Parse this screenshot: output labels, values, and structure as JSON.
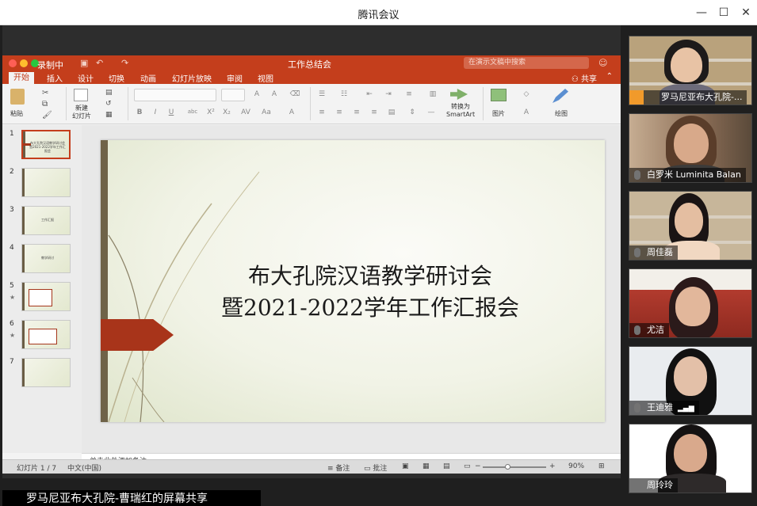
{
  "app": {
    "title": "腾讯会议"
  },
  "window_controls": {
    "minimize": "—",
    "maximize": "☐",
    "close": "✕"
  },
  "recording": {
    "label": "录制中"
  },
  "ppt": {
    "doc_title": "工作总结会",
    "search_placeholder": "在演示文稿中搜索",
    "tabs": [
      "开始",
      "插入",
      "设计",
      "切换",
      "动画",
      "幻灯片放映",
      "审阅",
      "视图"
    ],
    "active_tab": "开始",
    "share_label": "共享",
    "ribbon": {
      "paste": "粘贴",
      "new_slide": "新建\n幻灯片",
      "convert_smartart": "转换为\nSmartArt",
      "picture": "图片",
      "draw": "绘图"
    },
    "thumbnails": [
      {
        "num": "1",
        "text": "布大孔院汉语教学研讨会暨2021-2022学年工作汇报会",
        "star": ""
      },
      {
        "num": "2",
        "text": "",
        "star": ""
      },
      {
        "num": "3",
        "text": "工作汇报",
        "star": ""
      },
      {
        "num": "4",
        "text": "教学研讨",
        "star": ""
      },
      {
        "num": "5",
        "text": "",
        "star": "★"
      },
      {
        "num": "6",
        "text": "",
        "star": "★"
      },
      {
        "num": "7",
        "text": "",
        "star": ""
      }
    ],
    "slide": {
      "title_line1": "布大孔院汉语教学研讨会",
      "title_line2": "暨2021-2022学年工作汇报会"
    },
    "notes_placeholder": "单击此处添加备注",
    "status": {
      "slide_counter": "幻灯片 1 / 7",
      "language": "中文(中国)",
      "notes": "备注",
      "comments": "批注",
      "zoom": "90%"
    }
  },
  "share_banner": {
    "label": "罗马尼亚布大孔院-曹瑞红的屏幕共享"
  },
  "participants": [
    {
      "name": "罗马尼亚布大孔院-...",
      "bg": "#b9a27c",
      "skin": "#e8c3a5",
      "hair": "#1d1a1a",
      "shirt": "#6d6b7a",
      "avatar": true
    },
    {
      "name": "白罗米 Luminita Balan",
      "bg": "#a0826a",
      "skin": "#d8a98a",
      "hair": "#5a3d2a",
      "shirt": "#3c3b3a",
      "avatar": false
    },
    {
      "name": "周佳磊",
      "bg": "#c7b69a",
      "skin": "#e4bea1",
      "hair": "#1a1414",
      "shirt": "#f1d8c2",
      "avatar": false
    },
    {
      "name": "尤洁",
      "bg": "#b23b2e",
      "skin": "#e2b79b",
      "hair": "#2b1a1a",
      "shirt": "#2a2626",
      "avatar": false
    },
    {
      "name": "王迪雅",
      "bg": "#e9ecef",
      "skin": "#e3c0a8",
      "hair": "#111111",
      "shirt": "#fafafa",
      "avatar": false
    },
    {
      "name": "周玲玲",
      "bg": "#ffffff",
      "skin": "#d9a98c",
      "hair": "#151212",
      "shirt": "#2e2a2a",
      "avatar": false
    }
  ]
}
